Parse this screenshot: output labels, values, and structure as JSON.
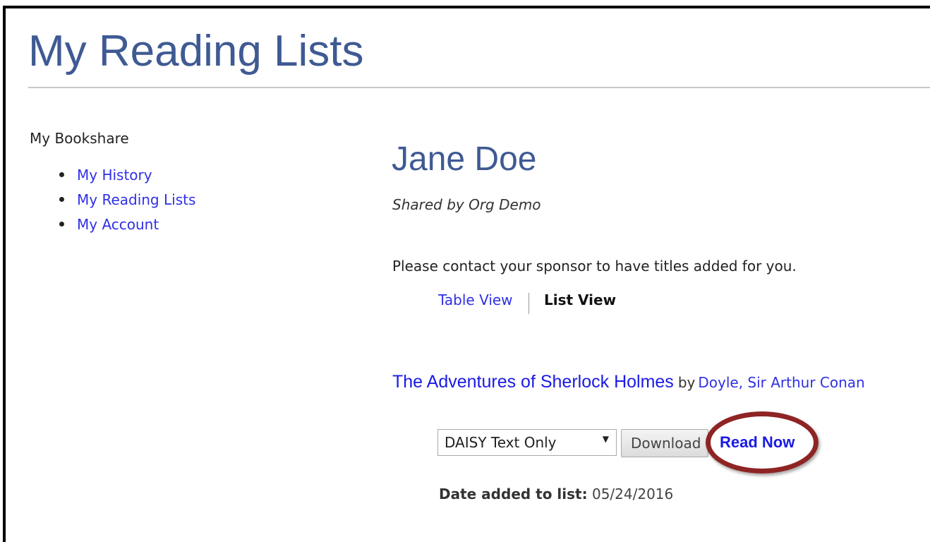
{
  "page": {
    "title": "My Reading Lists"
  },
  "sidebar": {
    "heading": "My Bookshare",
    "items": [
      {
        "label": "My History"
      },
      {
        "label": "My Reading Lists"
      },
      {
        "label": "My Account"
      }
    ]
  },
  "main": {
    "user_name": "Jane Doe",
    "shared_by": "Shared by Org Demo",
    "notice": "Please contact your sponsor to have titles added for you.",
    "views": {
      "table": "Table View",
      "list": "List View"
    },
    "book": {
      "title": "The Adventures of Sherlock Holmes",
      "by": "by",
      "author": "Doyle, Sir Arthur Conan",
      "format_selected": "DAISY Text Only",
      "download_label": "Download",
      "read_now_label": "Read Now",
      "date_label": "Date added to list:",
      "date_value": "05/24/2016"
    }
  },
  "colors": {
    "heading": "#3f5a93",
    "link": "#3030e6",
    "highlight": "#8e2424"
  }
}
